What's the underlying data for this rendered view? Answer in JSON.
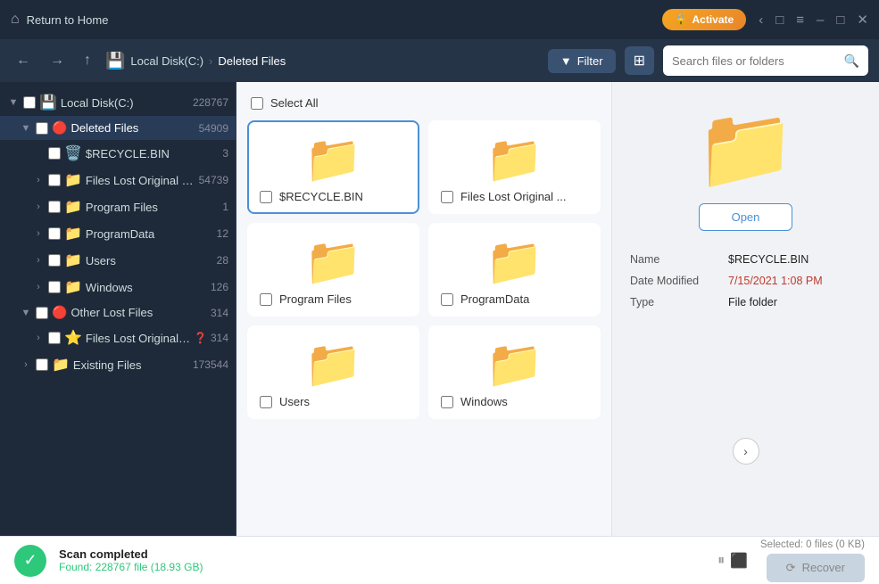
{
  "titlebar": {
    "home_label": "Return to Home",
    "activate_label": "Activate",
    "lock_icon": "🔒"
  },
  "navbar": {
    "breadcrumb": {
      "disk_icon": "💾",
      "disk_label": "Local Disk(C:)",
      "sep": "›",
      "folder_label": "Deleted Files"
    },
    "filter_label": "Filter",
    "search_placeholder": "Search files or folders"
  },
  "sidebar": {
    "items": [
      {
        "id": "local-disk",
        "label": "Local Disk(C:)",
        "count": "228767",
        "level": 0,
        "toggle": "▼",
        "icon": "💾",
        "type": "disk"
      },
      {
        "id": "deleted-files",
        "label": "Deleted Files",
        "count": "54909",
        "level": 1,
        "toggle": "▼",
        "icon": "🔴",
        "type": "folder-red",
        "selected": true
      },
      {
        "id": "recycle-bin",
        "label": "$RECYCLE.BIN",
        "count": "3",
        "level": 2,
        "toggle": "",
        "icon": "🗑️",
        "type": "recycle"
      },
      {
        "id": "files-lost-original",
        "label": "Files Lost Original Di...",
        "count": "54739",
        "level": 2,
        "toggle": "›",
        "icon": "📁",
        "type": "folder"
      },
      {
        "id": "program-files",
        "label": "Program Files",
        "count": "1",
        "level": 2,
        "toggle": "›",
        "icon": "📁",
        "type": "folder"
      },
      {
        "id": "program-data",
        "label": "ProgramData",
        "count": "12",
        "level": 2,
        "toggle": "›",
        "icon": "📁",
        "type": "folder"
      },
      {
        "id": "users",
        "label": "Users",
        "count": "28",
        "level": 2,
        "toggle": "›",
        "icon": "📁",
        "type": "folder"
      },
      {
        "id": "windows",
        "label": "Windows",
        "count": "126",
        "level": 2,
        "toggle": "›",
        "icon": "📁",
        "type": "folder"
      },
      {
        "id": "other-lost-files",
        "label": "Other Lost Files",
        "count": "314",
        "level": 1,
        "toggle": "▼",
        "icon": "🔴",
        "type": "folder-red"
      },
      {
        "id": "files-lost-original2",
        "label": "Files Lost Original ...",
        "count": "314",
        "level": 2,
        "toggle": "›",
        "icon": "⭐",
        "type": "star",
        "has_help": true
      },
      {
        "id": "existing-files",
        "label": "Existing Files",
        "count": "173544",
        "level": 1,
        "toggle": "›",
        "icon": "📁",
        "type": "folder"
      }
    ]
  },
  "file_area": {
    "select_all_label": "Select All",
    "folders": [
      {
        "id": "recycle-bin-folder",
        "label": "$RECYCLE.BIN",
        "active": true
      },
      {
        "id": "files-lost-original-folder",
        "label": "Files Lost Original ..."
      },
      {
        "id": "program-files-folder",
        "label": "Program Files"
      },
      {
        "id": "program-data-folder",
        "label": "ProgramData"
      },
      {
        "id": "users-folder",
        "label": "Users"
      },
      {
        "id": "windows-folder",
        "label": "Windows"
      }
    ]
  },
  "detail_panel": {
    "open_label": "Open",
    "name_label": "Name",
    "name_value": "$RECYCLE.BIN",
    "date_label": "Date Modified",
    "date_value": "7/15/2021 1:08 PM",
    "type_label": "Type",
    "type_value": "File folder"
  },
  "bottom_bar": {
    "scan_complete": "Scan completed",
    "found_label": "Found: 228767 file (18.93 GB)",
    "selected_info": "Selected: 0 files (0 KB)",
    "recover_label": "Recover"
  }
}
